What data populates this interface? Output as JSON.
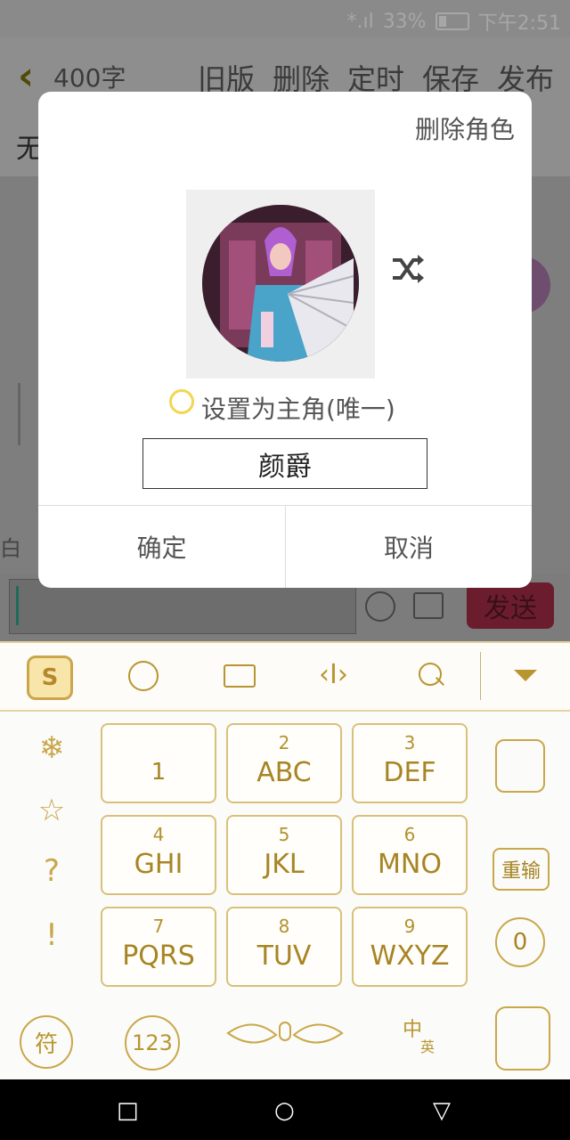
{
  "status_bar": {
    "signal": "*.ıl",
    "battery": "33%",
    "time": "下午2:51"
  },
  "header": {
    "back_icon": "chevron-left-icon",
    "word_count": "400字",
    "actions": [
      "旧版",
      "删除",
      "定时",
      "保存",
      "发布"
    ]
  },
  "background": {
    "row1_text": "无",
    "left_button": "白",
    "send_label": "发送"
  },
  "dialog": {
    "delete_role": "删除角色",
    "set_main_label": "设置为主角(唯一)",
    "name_value": "颜爵",
    "confirm": "确定",
    "cancel": "取消"
  },
  "keyboard": {
    "toolbar_icons": [
      "sogou-logo-icon",
      "emoji-icon",
      "keyboard-icon",
      "cursor-icon",
      "search-icon",
      "collapse-icon"
    ],
    "keys": [
      {
        "num": "",
        "letters": "1"
      },
      {
        "num": "2",
        "letters": "ABC"
      },
      {
        "num": "3",
        "letters": "DEF"
      },
      {
        "num": "4",
        "letters": "GHI"
      },
      {
        "num": "5",
        "letters": "JKL"
      },
      {
        "num": "6",
        "letters": "MNO"
      },
      {
        "num": "7",
        "letters": "PQRS"
      },
      {
        "num": "8",
        "letters": "TUV"
      },
      {
        "num": "9",
        "letters": "WXYZ"
      }
    ],
    "left_column": [
      "❄",
      "☆",
      "?",
      "!"
    ],
    "right_column": {
      "reenter": "重输",
      "zero": "0"
    },
    "bottom_row": {
      "symbol": "符",
      "numbers": "123",
      "chinese": "中",
      "english": "英"
    }
  },
  "navbar": {
    "recent": "□",
    "home": "○",
    "back": "▽"
  },
  "colors": {
    "accent_gold": "#b3922e",
    "radio_yellow": "#f2d64f",
    "send_bg": "#6b1d2e"
  }
}
